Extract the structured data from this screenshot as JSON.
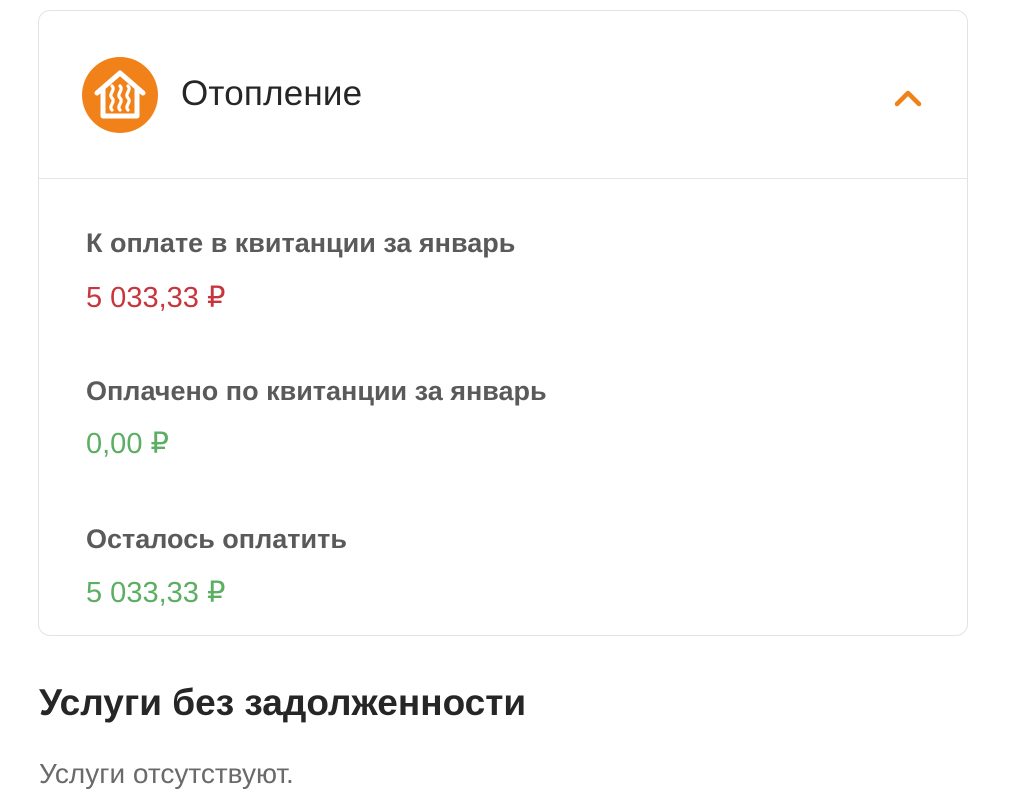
{
  "colors": {
    "accent": "#f08219",
    "due": "#c8363d",
    "paid": "#5cae63",
    "label": "#5a5a5a",
    "title": "#262626",
    "muted": "#6a6a6a",
    "border": "#e3e3e3"
  },
  "service_card": {
    "icon": "heating-house-icon",
    "title": "Отопление",
    "toggle_icon": "chevron-up-icon",
    "expanded": true,
    "rows": [
      {
        "label": "К оплате в квитанции за январь",
        "value": "5 033,33 ₽",
        "status": "due"
      },
      {
        "label": "Оплачено по квитанции за январь",
        "value": "0,00 ₽",
        "status": "paid"
      },
      {
        "label": "Осталось оплатить",
        "value": "5 033,33 ₽",
        "status": "paid"
      }
    ]
  },
  "no_debt_section": {
    "title": "Услуги без задолженности",
    "empty_text": "Услуги отсутствуют."
  }
}
